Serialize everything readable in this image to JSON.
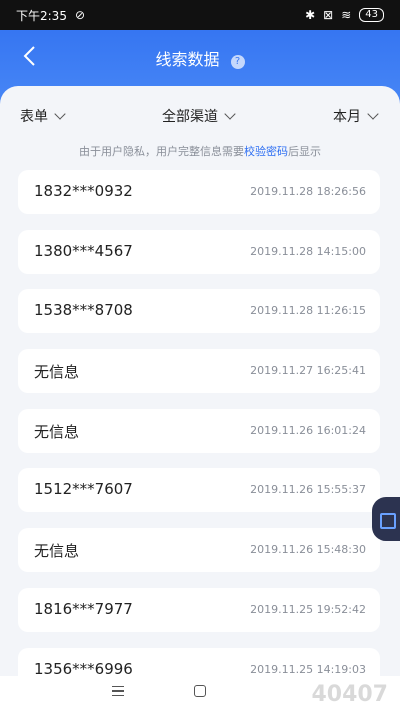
{
  "status": {
    "time": "下午2:35",
    "battery": "43"
  },
  "nav": {
    "title": "线索数据",
    "help": "?"
  },
  "filters": {
    "form": "表单",
    "channel": "全部渠道",
    "period": "本月"
  },
  "notice": {
    "prefix": "由于用户隐私，用户完整信息需要",
    "link": "校验密码",
    "suffix": "后显示"
  },
  "leads": [
    {
      "phone": "1832***0932",
      "time": "2019.11.28 18:26:56"
    },
    {
      "phone": "1380***4567",
      "time": "2019.11.28 14:15:00"
    },
    {
      "phone": "1538***8708",
      "time": "2019.11.28 11:26:15"
    },
    {
      "phone": "无信息",
      "time": "2019.11.27 16:25:41"
    },
    {
      "phone": "无信息",
      "time": "2019.11.26 16:01:24"
    },
    {
      "phone": "1512***7607",
      "time": "2019.11.26 15:55:37"
    },
    {
      "phone": "无信息",
      "time": "2019.11.26 15:48:30"
    },
    {
      "phone": "1816***7977",
      "time": "2019.11.25 19:52:42"
    },
    {
      "phone": "1356***6996",
      "time": "2019.11.25 14:19:03"
    }
  ],
  "watermark": "40407"
}
